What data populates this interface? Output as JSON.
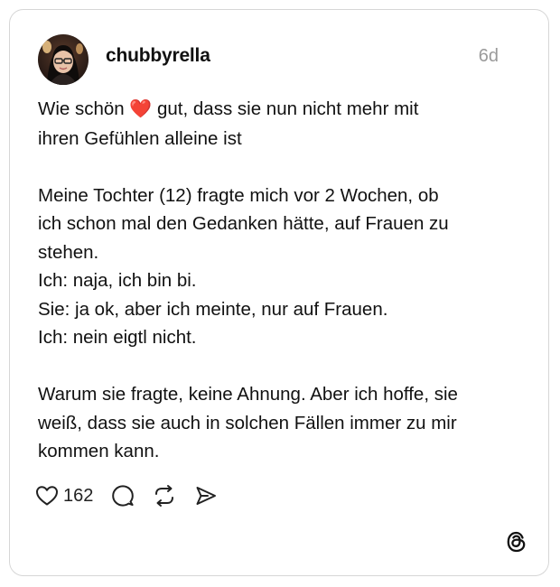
{
  "post": {
    "username": "chubbyrella",
    "timestamp": "6d",
    "avatar_icon": "profile-photo",
    "text": {
      "line1_before": "Wie schön ",
      "line1_emoji": "❤️",
      "line1_after": " gut, dass sie nun nicht mehr mit",
      "lines": [
        "ihren Gefühlen alleine ist",
        "",
        "Meine Tochter (12) fragte mich vor 2 Wochen, ob",
        "ich schon mal den Gedanken hätte, auf Frauen zu",
        "stehen.",
        "Ich: naja, ich bin bi.",
        "Sie: ja ok, aber ich meinte, nur auf Frauen.",
        "Ich: nein eigtl nicht.",
        "",
        "Warum sie fragte, keine Ahnung. Aber ich hoffe, sie",
        "weiß, dass sie auch in solchen Fällen immer zu mir",
        "kommen kann."
      ]
    }
  },
  "actions": {
    "like_count": "162",
    "like_icon": "heart-outline-icon",
    "reply_icon": "comment-bubble-icon",
    "repost_icon": "repost-icon",
    "share_icon": "send-icon"
  },
  "branding": {
    "logo_icon": "threads-logo-icon"
  },
  "colors": {
    "text": "#111111",
    "muted": "#9a9a9a",
    "border": "#d6d6d6",
    "heart": "#e0202a"
  }
}
